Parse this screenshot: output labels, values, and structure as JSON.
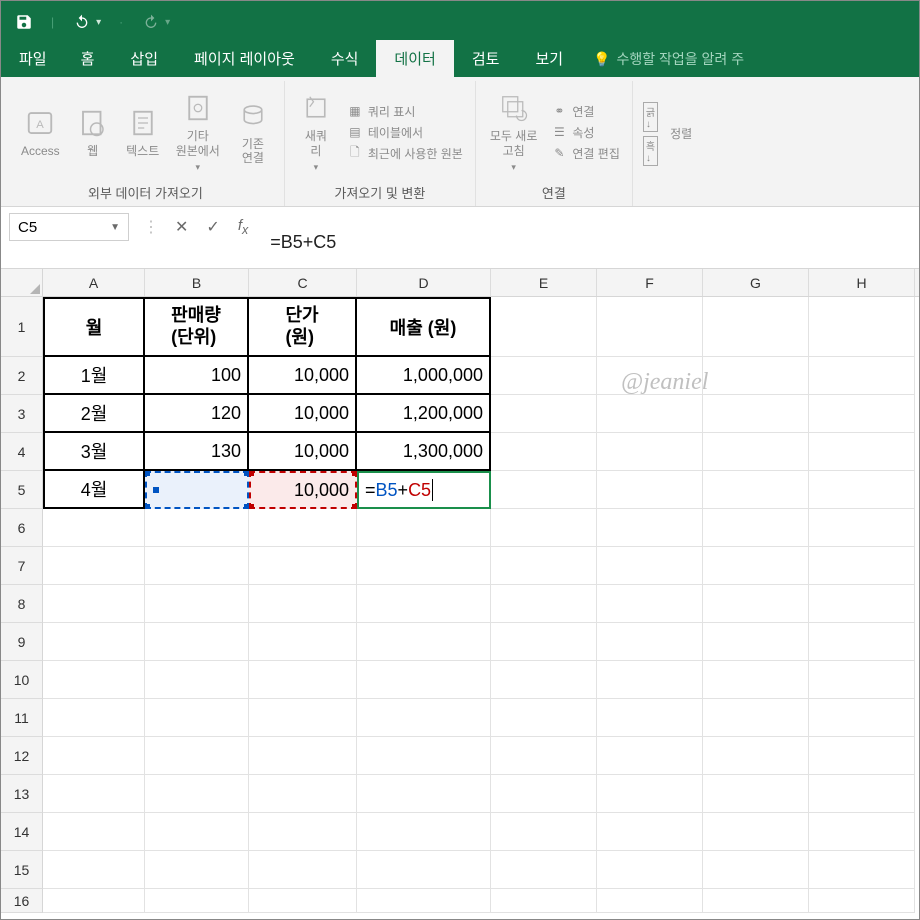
{
  "titlebar": {
    "save": "save",
    "undo": "undo",
    "redo": "redo"
  },
  "tabs": {
    "file": "파일",
    "home": "홈",
    "insert": "삽입",
    "page_layout": "페이지 레이아웃",
    "formulas": "수식",
    "data": "데이터",
    "review": "검토",
    "view": "보기",
    "tell_me": "수행할 작업을 알려 주"
  },
  "ribbon": {
    "ext_data": {
      "access": "Access",
      "web": "웹",
      "text": "텍스트",
      "other_src": "기타\n원본에서",
      "existing_conn": "기존\n연결",
      "group_label": "외부 데이터 가져오기"
    },
    "get_transform": {
      "new_query": "새쿼\n리",
      "show_query": "쿼리 표시",
      "from_table": "테이블에서",
      "recent_src": "최근에 사용한 원본",
      "group_label": "가져오기 및 변환"
    },
    "connections": {
      "refresh_all": "모두 새로\n고침",
      "connections": "연결",
      "properties": "속성",
      "edit_links": "연결 편집",
      "group_label": "연결"
    },
    "sort": {
      "asc": "긁↓",
      "desc": "흑↓",
      "sort_label": "정렬"
    }
  },
  "namebox": "C5",
  "formula": "=B5+C5",
  "columns": [
    "A",
    "B",
    "C",
    "D",
    "E",
    "F",
    "G",
    "H"
  ],
  "row_numbers": [
    1,
    2,
    3,
    4,
    5,
    6,
    7,
    8,
    9,
    10,
    11,
    12,
    13,
    14,
    15,
    16
  ],
  "table": {
    "headers": {
      "A": "월",
      "B": "판매량\n(단위)",
      "C": "단가\n(원)",
      "D": "매출 (원)"
    },
    "r2": {
      "A": "1월",
      "B": "100",
      "C": "10,000",
      "D": "1,000,000"
    },
    "r3": {
      "A": "2월",
      "B": "120",
      "C": "10,000",
      "D": "1,200,000"
    },
    "r4": {
      "A": "3월",
      "B": "130",
      "C": "10,000",
      "D": "1,300,000"
    },
    "r5": {
      "A": "4월",
      "B": "",
      "C": "10,000"
    }
  },
  "d5_formula": {
    "eq": "=",
    "ref1": "B5",
    "plus": "+",
    "ref2": "C5"
  },
  "watermark": "@jeaniel"
}
